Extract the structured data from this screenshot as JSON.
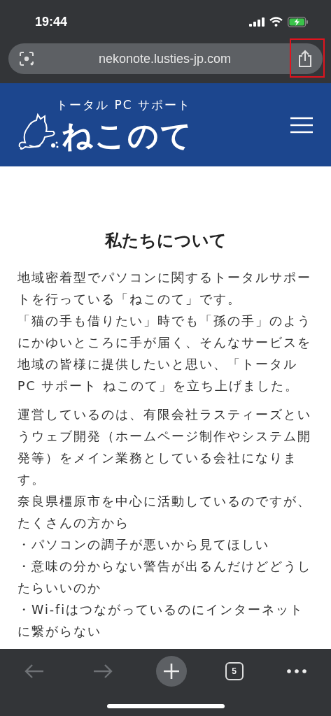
{
  "status_bar": {
    "time": "19:44",
    "battery_charging": true
  },
  "address_bar": {
    "url": "nekonote.lusties-jp.com",
    "share_highlighted": true
  },
  "site_header": {
    "tagline": "トータル PC サポート",
    "logo_text": "ねこのて"
  },
  "article": {
    "title": "私たちについて",
    "paragraphs": [
      [
        "地域密着型でパソコンに関するトータルサポートを行っている「ねこのて」です。",
        "「猫の手も借りたい」時でも「孫の手」のようにかゆいところに手が届く、そんなサービスを地域の皆様に提供したいと思い、「トータルPC サポート ねこのて」を立ち上げました。"
      ],
      [
        "運営しているのは、有限会社ラスティーズというウェブ開発（ホームページ制作やシステム開発等）をメイン業務としている会社になります。",
        "奈良県橿原市を中心に活動しているのですが、たくさんの方から",
        "・パソコンの調子が悪いから見てほしい",
        "・意味の分からない警告が出るんだけどどうしたらいいのか",
        "・Wi-fiはつながっているのにインターネットに繋がらない"
      ]
    ]
  },
  "toolbar": {
    "back_disabled": true,
    "forward_disabled": true,
    "tab_count": "5"
  }
}
